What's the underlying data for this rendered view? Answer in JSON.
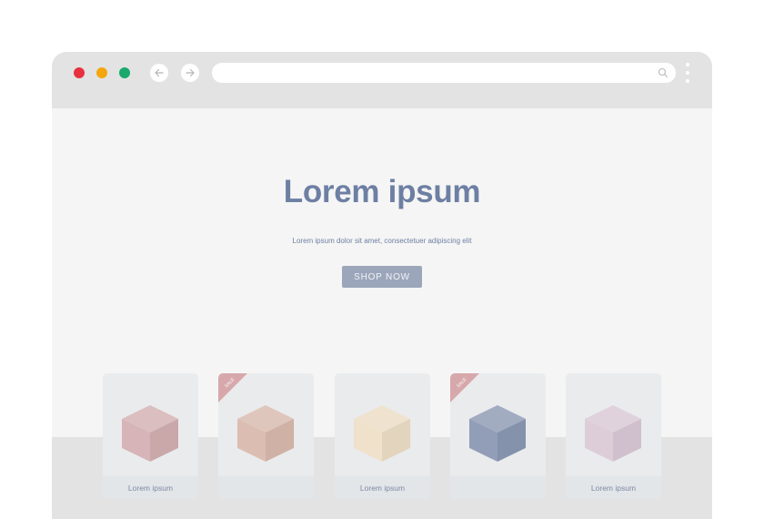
{
  "browser": {
    "window_controls": {
      "close_color": "#e8313f",
      "minimize_color": "#f5a60c",
      "maximize_color": "#1aa86c"
    },
    "nav": {
      "back_icon": "arrow-left-icon",
      "forward_icon": "arrow-right-icon"
    },
    "address_bar": {
      "value": "",
      "icon": "search-icon"
    },
    "menu_icon": "kebab-menu-icon"
  },
  "hero": {
    "title": "Lorem ipsum",
    "subtitle": "Lorem ipsum dolor sit amet, consectetuer adipiscing elit",
    "cta_label": "SHOP NOW",
    "title_color": "#6d7fa3",
    "cta_color": "#9ca6bb"
  },
  "products": [
    {
      "label": "Lorem ipsum",
      "sale": false,
      "ribbon": "",
      "color": "#d5b1b4"
    },
    {
      "label": "",
      "sale": true,
      "ribbon": "SALE",
      "color": "#dbbbae"
    },
    {
      "label": "Lorem ipsum",
      "sale": false,
      "ribbon": "",
      "color": "#efe0c8"
    },
    {
      "label": "",
      "sale": true,
      "ribbon": "SALE",
      "color": "#8d9ab5"
    },
    {
      "label": "Lorem ipsum",
      "sale": false,
      "ribbon": "",
      "color": "#dccbd8"
    }
  ]
}
